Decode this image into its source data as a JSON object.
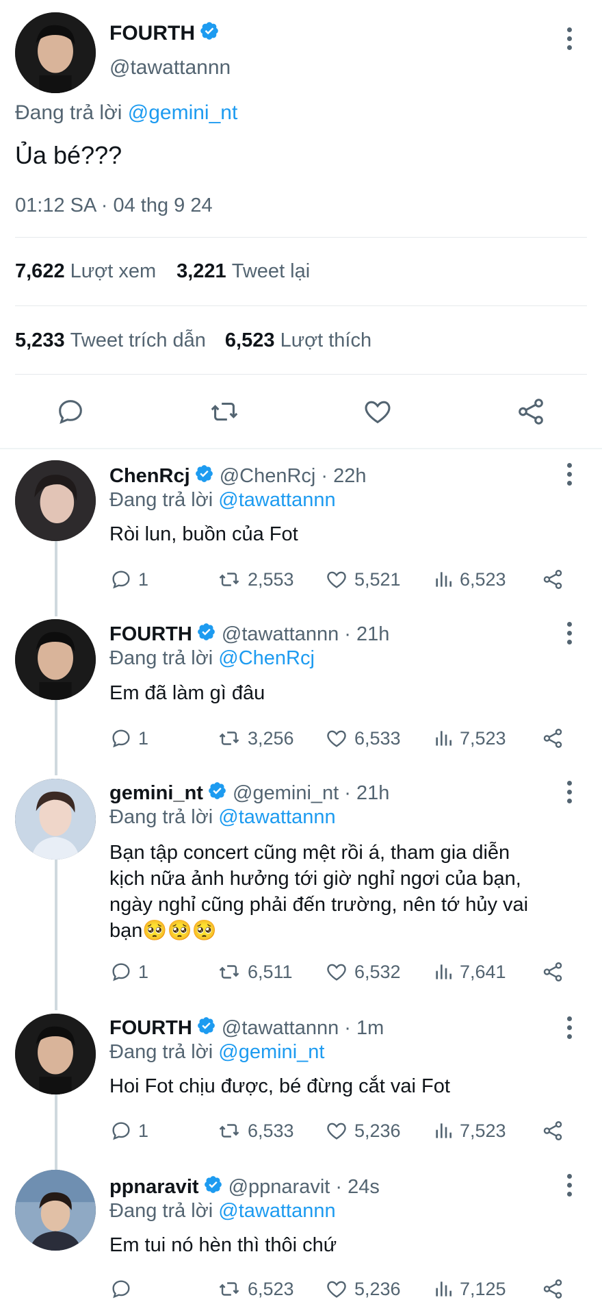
{
  "main_tweet": {
    "name": "FOURTH",
    "handle": "@tawattannn",
    "replying_prefix": "Đang trả lời",
    "replying_to": "@gemini_nt",
    "text": "Ủa bé???",
    "timestamp": "01:12 SA · 04 thg 9 24",
    "views_count": "7,622",
    "views_label": "Lượt xem",
    "retweets_count": "3,221",
    "retweets_label": "Tweet lại",
    "quotes_count": "5,233",
    "quotes_label": "Tweet trích dẫn",
    "likes_count": "6,523",
    "likes_label": "Lượt thích"
  },
  "replies": [
    {
      "name": "ChenRcj",
      "handle": "@ChenRcj",
      "time": "· 22h",
      "replying_prefix": "Đang trả lời",
      "replying_to": "@tawattannn",
      "text": "Ròi lun, buồn của Fot",
      "replies": "1",
      "retweets": "2,553",
      "likes": "5,521",
      "views": "6,523"
    },
    {
      "name": "FOURTH",
      "handle": "@tawattannn",
      "time": "· 21h",
      "replying_prefix": "Đang trả lời",
      "replying_to": "@ChenRcj",
      "text": "Em đã làm gì đâu",
      "replies": "1",
      "retweets": "3,256",
      "likes": "6,533",
      "views": "7,523"
    },
    {
      "name": "gemini_nt",
      "handle": "@gemini_nt",
      "time": "· 21h",
      "replying_prefix": "Đang trả lời",
      "replying_to": "@tawattannn",
      "text_lines": [
        "Bạn tập concert cũng mệt rồi á, tham gia diễn",
        "kịch nữa ảnh hưởng tới giờ nghỉ ngơi của bạn,",
        "ngày nghỉ cũng phải đến trường, nên tớ hủy vai",
        "bạn🥺🥺🥺"
      ],
      "replies": "1",
      "retweets": "6,511",
      "likes": "6,532",
      "views": "7,641"
    },
    {
      "name": "FOURTH",
      "handle": "@tawattannn",
      "time": "· 1m",
      "replying_prefix": "Đang trả lời",
      "replying_to": "@gemini_nt",
      "text": "Hoi Fot chịu được, bé đừng cắt vai Fot",
      "replies": "1",
      "retweets": "6,533",
      "likes": "5,236",
      "views": "7,523"
    },
    {
      "name": "ppnaravit",
      "handle": "@ppnaravit",
      "time": "· 24s",
      "replying_prefix": "Đang trả lời",
      "replying_to": "@tawattannn",
      "text": "Em tui nó hèn thì thôi chứ",
      "replies": "",
      "retweets": "6,523",
      "likes": "5,236",
      "views": "7,125"
    }
  ],
  "icons": {
    "reply": "reply-icon",
    "retweet": "retweet-icon",
    "like": "like-icon",
    "views": "views-icon",
    "share": "share-icon",
    "verified": "verified-badge-icon",
    "more": "more-options-icon"
  },
  "colors": {
    "link": "#1d9bf0",
    "secondary_text": "#536471",
    "verified": "#1d9bf0"
  }
}
